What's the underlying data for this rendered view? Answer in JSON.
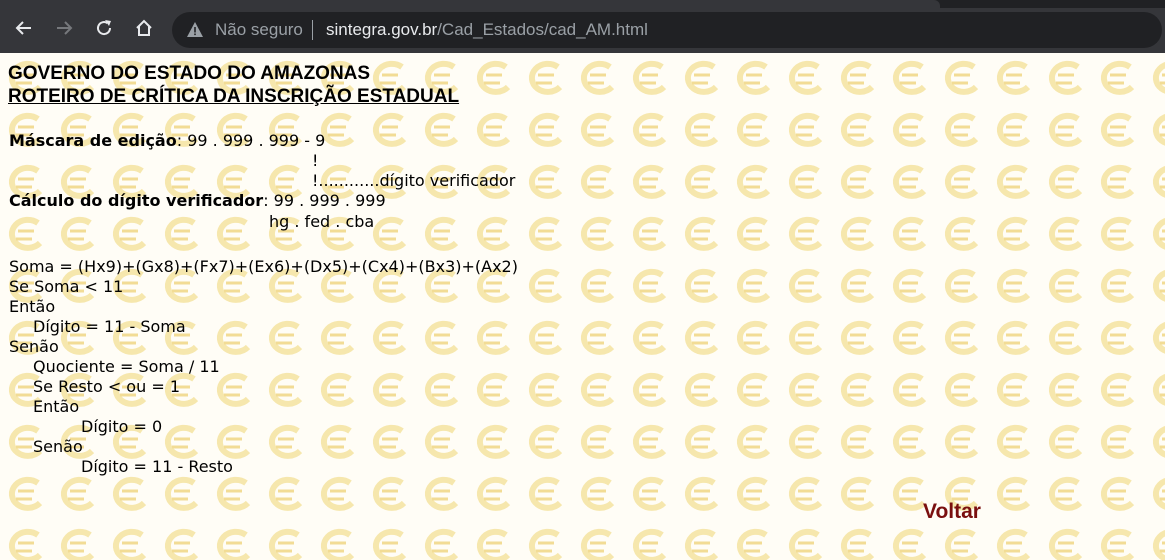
{
  "browser": {
    "insecure_label": "Não seguro",
    "url_host": "sintegra.gov.br",
    "url_path": "/Cad_Estados/cad_AM.html"
  },
  "page": {
    "title": "GOVERNO DO ESTADO DO AMAZONAS",
    "subtitle": "ROTEIRO DE CRÍTICA DA INSCRIÇÃO ESTADUAL",
    "mask_label": "Máscara de edição",
    "mask_value": ": 99 . 999 . 999 - 9",
    "mask_pointer": "!",
    "mask_pointer_note": "!............dígito verificador",
    "calc_label": "Cálculo do dígito verificador",
    "calc_value": ": 99 . 999 . 999",
    "calc_letters": "hg . fed . cba",
    "algorithm": [
      "Soma = (Hx9)+(Gx8)+(Fx7)+(Ex6)+(Dx5)+(Cx4)+(Bx3)+(Ax2)",
      "Se Soma < 11",
      "Então",
      "Dígito = 11 - Soma",
      "Senão",
      "Quociente = Soma / 11",
      "Se Resto < ou = 1",
      "Então",
      "Dígito = 0",
      "Senão",
      "Dígito = 11 - Resto"
    ],
    "back_link": "Voltar"
  }
}
